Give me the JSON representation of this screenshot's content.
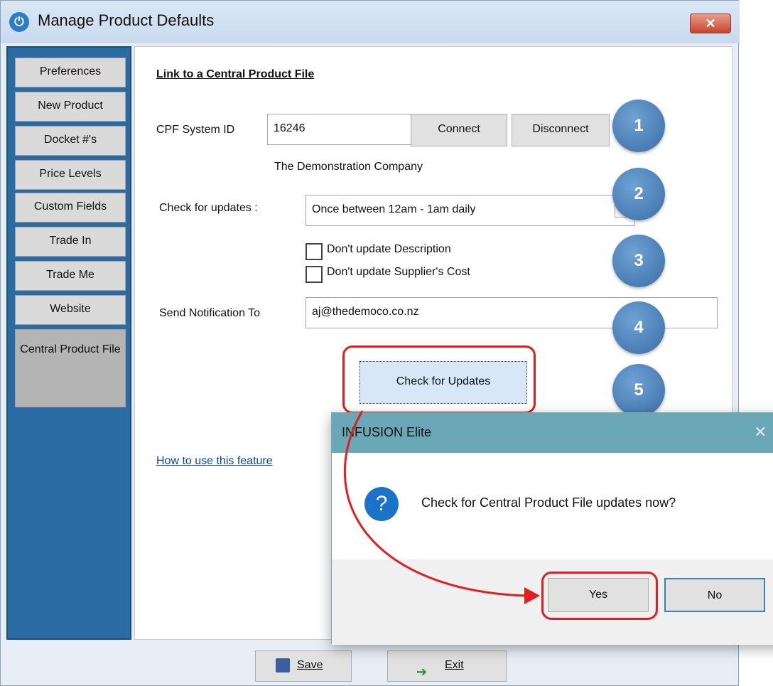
{
  "window": {
    "title": "Manage Product Defaults",
    "close_symbol": "✕",
    "app_icon_symbol": "⏻"
  },
  "sidebar": {
    "items": [
      {
        "label": "Preferences"
      },
      {
        "label": "New Product"
      },
      {
        "label": "Docket #'s"
      },
      {
        "label": "Price Levels"
      },
      {
        "label": "Custom Fields"
      },
      {
        "label": "Trade In"
      },
      {
        "label": "Trade Me"
      },
      {
        "label": "Website"
      },
      {
        "label": "Central Product File",
        "active": true
      }
    ]
  },
  "panel": {
    "heading": "Link to a Central Product File",
    "cpf_label": "CPF System ID",
    "cpf_value": "16246",
    "connect_label": "Connect",
    "disconnect_label": "Disconnect",
    "company_name": "The Demonstration Company",
    "check_updates_label": "Check for updates :",
    "check_updates_value": "Once between 12am - 1am daily",
    "dont_update_description": "Don't update Description",
    "dont_update_cost": "Don't update Supplier's Cost",
    "notification_label": "Send Notification To",
    "notification_value": "aj@thedemoco.co.nz",
    "check_now_button": "Check for Updates",
    "help_link": "How to use this feature"
  },
  "badges": [
    "1",
    "2",
    "3",
    "4",
    "5"
  ],
  "footer": {
    "save_label": "Save",
    "exit_label": "Exit"
  },
  "dialog": {
    "title": "INFUSION Elite",
    "close_symbol": "✕",
    "question_symbol": "?",
    "message": "Check for Central Product File updates now?",
    "yes_label": "Yes",
    "no_label": "No"
  },
  "colors": {
    "sidebar": "#2a6ba4",
    "badge": "#4a7fb8",
    "annotation": "#e02020",
    "dialog_titlebar": "#6aa7b7"
  }
}
